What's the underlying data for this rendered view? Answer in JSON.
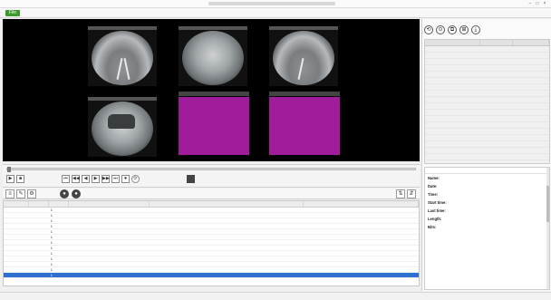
{
  "window": {
    "title": "",
    "min_glyph": "–",
    "max_glyph": "□",
    "close_glyph": "×"
  },
  "menu": [
    {
      "label": "File",
      "active": true
    },
    {
      "label": ""
    },
    {
      "label": ""
    },
    {
      "label": ""
    },
    {
      "label": ""
    },
    {
      "label": ""
    }
  ],
  "viewer": {
    "label": "",
    "cameras": [
      {
        "caption": ""
      },
      {
        "caption": ""
      },
      {
        "caption": ""
      },
      {
        "caption": ""
      }
    ],
    "empty_tiles": [
      {
        "caption": "",
        "color": "#a01c9a"
      },
      {
        "caption": "",
        "color": "#a01c9a"
      }
    ]
  },
  "transport": {
    "position": 0,
    "buttons": [
      "▶",
      "■",
      "⏮",
      "◀◀",
      "◀",
      "▶",
      "▶▶",
      "⏭",
      "⏺",
      "⟳"
    ],
    "time_a": "",
    "time_b": "",
    "time_c": "",
    "right_a": "",
    "right_b": ""
  },
  "toolbar": {
    "hint_line1": "",
    "hint_line2": "",
    "icons": [
      "≡",
      "✎",
      "⚙",
      "●",
      "●"
    ],
    "right_icons": [
      "⇅",
      "⇵"
    ]
  },
  "stream_table": {
    "columns": [
      "",
      "",
      "",
      "",
      "",
      ""
    ],
    "rows": [
      [
        "",
        "",
        "1",
        "",
        "",
        ""
      ],
      [
        "",
        "",
        "1",
        "",
        "",
        ""
      ],
      [
        "",
        "",
        "1",
        "",
        "",
        ""
      ],
      [
        "",
        "",
        "1",
        "",
        "",
        ""
      ],
      [
        "",
        "",
        "1",
        "",
        "",
        ""
      ],
      [
        "",
        "",
        "1",
        "",
        "",
        ""
      ],
      [
        "",
        "",
        "1",
        "",
        "",
        ""
      ],
      [
        "",
        "",
        "1",
        "",
        "",
        ""
      ],
      [
        "",
        "",
        "1",
        "",
        "",
        ""
      ],
      [
        "",
        "",
        "1",
        "",
        "",
        ""
      ],
      [
        "",
        "",
        "1",
        "",
        "",
        ""
      ],
      [
        "",
        "",
        "1",
        "",
        "",
        ""
      ],
      [
        "",
        "",
        "1",
        "",
        "",
        ""
      ]
    ],
    "selected_row": 12
  },
  "right_panel": {
    "title": "",
    "icons": [
      "⟲",
      "⊙",
      "⧉",
      "⊞",
      "⤓"
    ],
    "columns": [
      "",
      "",
      ""
    ],
    "rows": [
      [
        "",
        "",
        ""
      ],
      [
        "",
        "",
        ""
      ],
      [
        "",
        "",
        ""
      ],
      [
        "",
        "",
        ""
      ],
      [
        "",
        "",
        ""
      ],
      [
        "",
        "",
        ""
      ],
      [
        "",
        "",
        ""
      ],
      [
        "",
        "",
        ""
      ],
      [
        "",
        "",
        ""
      ],
      [
        "",
        "",
        ""
      ],
      [
        "",
        "",
        ""
      ],
      [
        "",
        "",
        ""
      ],
      [
        "",
        "",
        ""
      ],
      [
        "",
        "",
        ""
      ],
      [
        "",
        "",
        ""
      ],
      [
        "",
        "",
        ""
      ],
      [
        "",
        "",
        ""
      ],
      [
        "",
        "",
        ""
      ]
    ]
  },
  "properties": {
    "header": "",
    "fields": [
      {
        "key": "Name:",
        "value": ""
      },
      {
        "key": "Date:",
        "value": ""
      },
      {
        "key": "Time:",
        "value": ""
      },
      {
        "key": "Start time:",
        "value": ""
      },
      {
        "key": "Last time:",
        "value": ""
      },
      {
        "key": "Length:",
        "value": ""
      },
      {
        "key": "Bits:",
        "value": ""
      }
    ],
    "items": [
      {
        "head": "",
        "lines": [
          "",
          "",
          "",
          "",
          ""
        ]
      },
      {
        "head": "",
        "lines": [
          "",
          "",
          "",
          "",
          ""
        ]
      }
    ]
  },
  "status": {
    "connected": "",
    "a": "",
    "b": "",
    "c": "",
    "d": "",
    "e": ""
  }
}
